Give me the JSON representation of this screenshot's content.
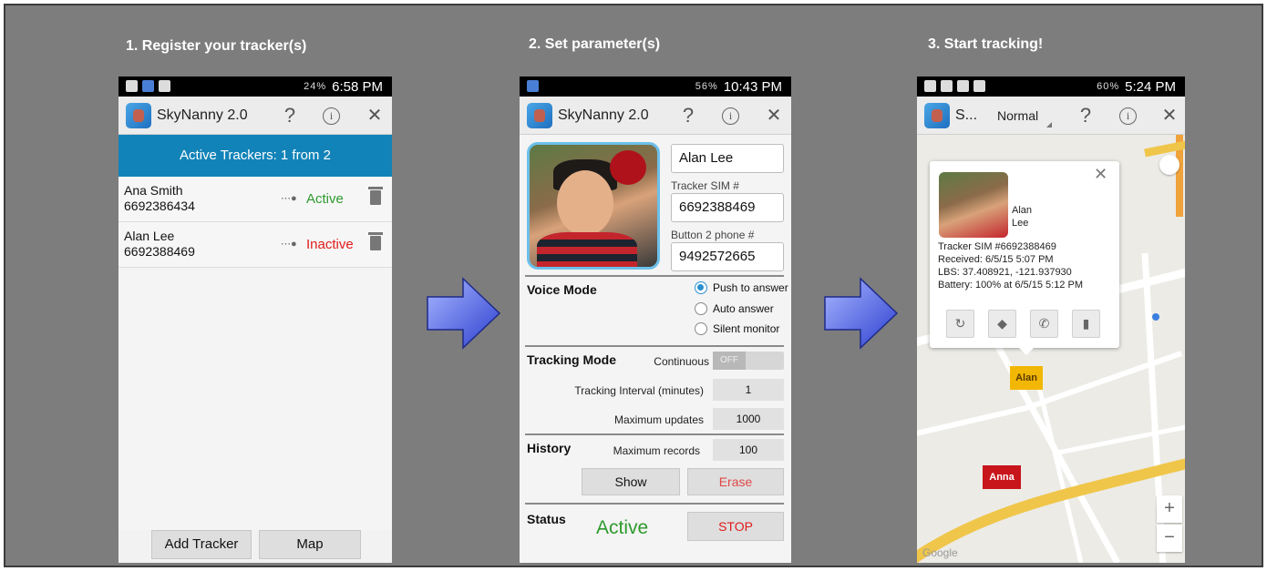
{
  "steps": {
    "step1": "1. Register your tracker(s)",
    "step2": "2. Set parameter(s)",
    "step3": "3. Start tracking!"
  },
  "phone1": {
    "time": "6:58 PM",
    "status_icons": "24%",
    "app_title": "SkyNanny 2.0",
    "help": "?",
    "info": "i",
    "close": "✕",
    "banner": "Active Trackers: 1 from 2",
    "trackers": [
      {
        "name": "Ana Smith",
        "phone": "6692386434",
        "state": "Active",
        "state_color": "#2e9a2e"
      },
      {
        "name": "Alan Lee",
        "phone": "6692388469",
        "state": "Inactive",
        "state_color": "#e01b1b"
      }
    ],
    "add_tracker": "Add Tracker",
    "map": "Map"
  },
  "phone2": {
    "time": "10:43 PM",
    "status_icons": "56%",
    "app_title": "SkyNanny 2.0",
    "help": "?",
    "info": "i",
    "close": "✕",
    "name_value": "Alan Lee",
    "sim_label": "Tracker SIM #",
    "sim_value": "6692388469",
    "button2_label": "Button 2 phone #",
    "button2_value": "9492572665",
    "voice_mode": "Voice Mode",
    "voice_options": [
      "Push to answer",
      "Auto answer",
      "Silent monitor"
    ],
    "voice_selected": 0,
    "tracking_mode": "Tracking Mode",
    "continuous": "Continuous",
    "continuous_state": "OFF",
    "interval_label": "Tracking Interval (minutes)",
    "interval_value": "1",
    "max_updates_label": "Maximum updates",
    "max_updates_value": "1000",
    "history": "History",
    "max_records_label": "Maximum records",
    "max_records_value": "100",
    "show": "Show",
    "erase": "Erase",
    "status": "Status",
    "status_value": "Active",
    "stop": "STOP"
  },
  "phone3": {
    "time": "5:24 PM",
    "status_icons": "60%",
    "app_title": "S...",
    "map_mode": "Normal",
    "help": "?",
    "info": "i",
    "close": "✕",
    "popup": {
      "first_name": "Alan",
      "last_name": "Lee",
      "sim": "Tracker SIM #6692388469",
      "received": "Received: 6/5/15 5:07 PM",
      "lbs": "LBS: 37.408921, -121.937930",
      "battery": "Battery: 100% at 6/5/15 5:12 PM",
      "close": "✕"
    },
    "marker_alan": "Alan",
    "marker_anna": "Anna",
    "zoom_in": "+",
    "zoom_out": "−",
    "google": "Google"
  },
  "colors": {
    "background": "#7d7d7d",
    "banner": "#1283b8",
    "active": "#2e9a2e",
    "inactive": "#e01b1b",
    "alan_marker": "#f2b705",
    "anna_marker": "#c8141b"
  }
}
